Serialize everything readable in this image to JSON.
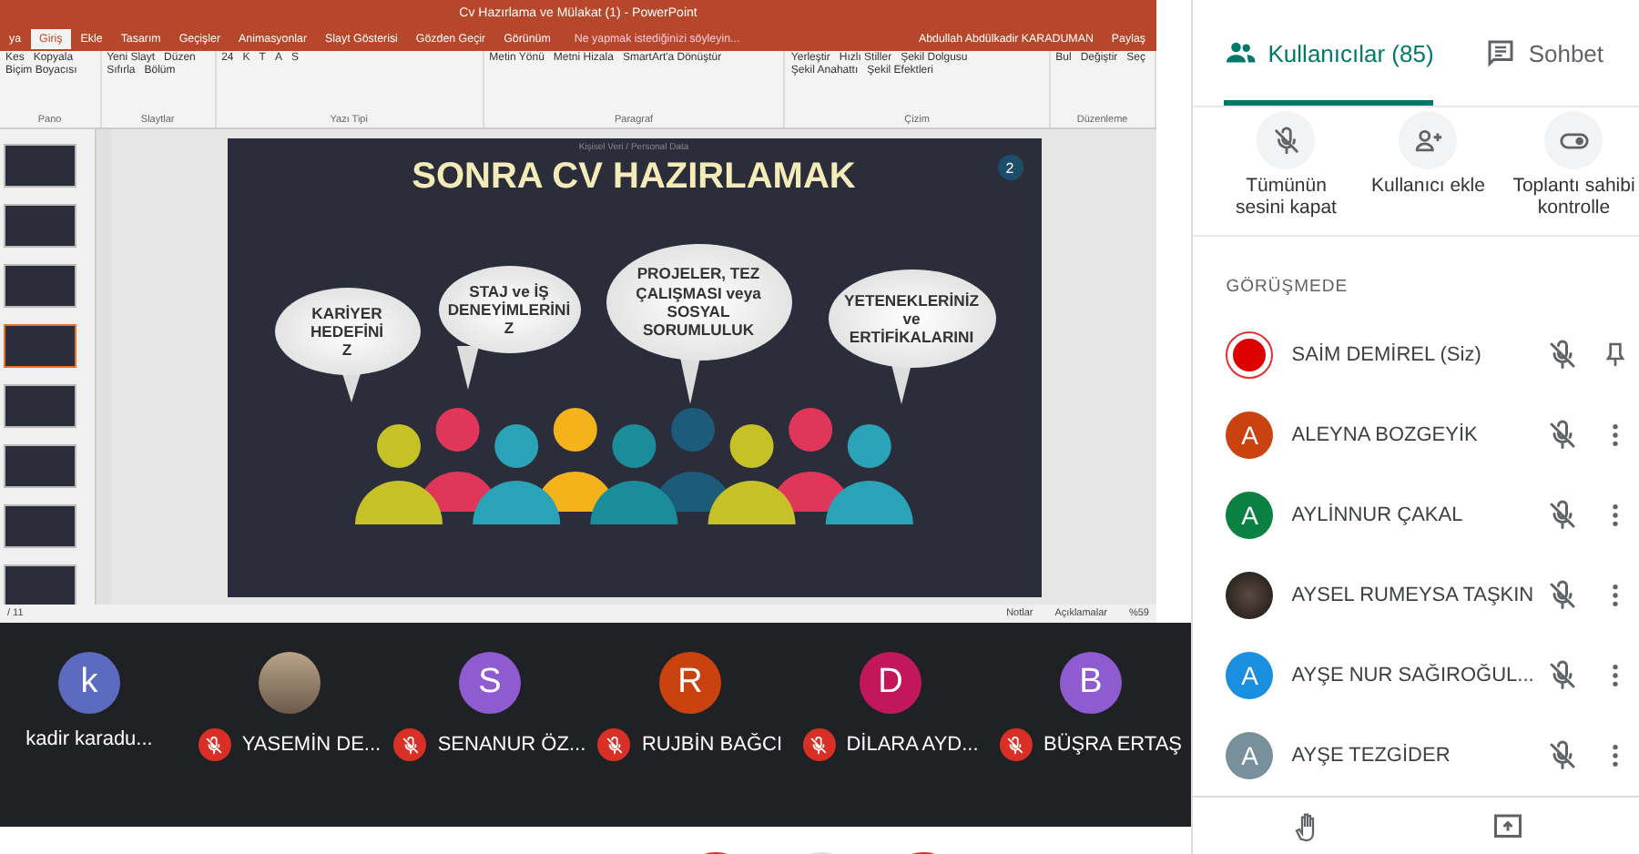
{
  "ppt": {
    "title": "Cv Hazırlama ve Mülakat (1) - PowerPoint",
    "tabs": [
      {
        "label": "ya",
        "selected": false
      },
      {
        "label": "Giriş",
        "selected": true
      },
      {
        "label": "Ekle",
        "selected": false
      },
      {
        "label": "Tasarım",
        "selected": false
      },
      {
        "label": "Geçişler",
        "selected": false
      },
      {
        "label": "Animasyonlar",
        "selected": false
      },
      {
        "label": "Slayt Gösterisi",
        "selected": false
      },
      {
        "label": "Gözden Geçir",
        "selected": false
      },
      {
        "label": "Görünüm",
        "selected": false
      }
    ],
    "tell_me": "Ne yapmak istediğinizi söyleyin...",
    "user": "Abdullah Abdülkadir KARADUMAN",
    "share": "Paylaş",
    "ribbon_groups": [
      {
        "label": "Pano",
        "items": [
          "Kes",
          "Kopyala",
          "Biçim Boyacısı"
        ]
      },
      {
        "label": "Slaytlar",
        "items": [
          "Yeni Slayt",
          "Düzen",
          "Sıfırla",
          "Bölüm"
        ]
      },
      {
        "label": "Yazı Tipi",
        "items": [
          "24",
          "K",
          "T",
          "A",
          "S"
        ]
      },
      {
        "label": "Paragraf",
        "items": [
          "Metin Yönü",
          "Metni Hizala",
          "SmartArt'a Dönüştür"
        ]
      },
      {
        "label": "Çizim",
        "items": [
          "Yerleştir",
          "Hızlı Stiller",
          "Şekil Dolgusu",
          "Şekil Anahattı",
          "Şekil Efektleri"
        ]
      },
      {
        "label": "Düzenleme",
        "items": [
          "Bul",
          "Değiştir",
          "Seç"
        ]
      }
    ],
    "thumbnails": [
      {
        "selected": false
      },
      {
        "selected": false
      },
      {
        "selected": false
      },
      {
        "selected": true
      },
      {
        "selected": false
      },
      {
        "selected": false
      },
      {
        "selected": false
      },
      {
        "selected": false
      }
    ],
    "slide": {
      "caption": "Kişisel Veri / Personal Data",
      "title": "SONRA CV HAZIRLAMAK",
      "number": "2",
      "bubbles": [
        {
          "lines": [
            "KARİYER",
            "HEDEFİNİ",
            "Z"
          ]
        },
        {
          "lines": [
            "STAJ ve İŞ",
            "DENEYİMLERİNİ",
            "Z"
          ]
        },
        {
          "lines": [
            "PROJELER, TEZ",
            "ÇALIŞMASI veya",
            "SOSYAL",
            "SORUMLULUK"
          ]
        },
        {
          "lines": [
            "YETENEKLERİNİZ",
            "ve",
            "ERTİFİKALARINI"
          ]
        }
      ]
    },
    "status": {
      "slide_count": "/ 11",
      "notes": "Notlar",
      "comments": "Açıklamalar",
      "zoom": "%59"
    }
  },
  "strip": [
    {
      "name": "kadir karadu...",
      "kind": "initial",
      "initial": "k",
      "color": "#5c6bc0",
      "muted": false
    },
    {
      "name": "YASEMİN DE...",
      "kind": "photo",
      "muted": true
    },
    {
      "name": "SENANUR ÖZ...",
      "kind": "initial",
      "initial": "S",
      "color": "#8e5bd0",
      "muted": true
    },
    {
      "name": "RUJBİN BAĞCI",
      "kind": "initial",
      "initial": "R",
      "color": "#c9420f",
      "muted": true
    },
    {
      "name": "DİLARA AYD...",
      "kind": "initial",
      "initial": "D",
      "color": "#c2185b",
      "muted": true
    },
    {
      "name": "BÜŞRA ERTAŞ",
      "kind": "initial",
      "initial": "B",
      "color": "#8e5bd0",
      "muted": true
    }
  ],
  "panel": {
    "tabs": [
      {
        "label": "Kullanıcılar (85)",
        "kind": "people",
        "selected": true
      },
      {
        "label": "Sohbet",
        "kind": "chat",
        "selected": false
      }
    ],
    "actions": [
      {
        "label": "Tümünün sesini kapat",
        "kind": "mute"
      },
      {
        "label": "Kullanıcı ekle",
        "kind": "add"
      },
      {
        "label": "Toplantı sahibi kontrolle",
        "kind": "toggle"
      }
    ],
    "section": "GÖRÜŞMEDE",
    "people": [
      {
        "name": "SAİM DEMİREL (Siz)",
        "kind": "logo",
        "self": true
      },
      {
        "name": "ALEYNA BOZGEYİK",
        "kind": "initial",
        "initial": "A",
        "color": "#c9420f",
        "self": false
      },
      {
        "name": "AYLİNNUR ÇAKAL",
        "kind": "initial",
        "initial": "A",
        "color": "#0b8043",
        "self": false
      },
      {
        "name": "AYSEL RUMEYSA TAŞKIN",
        "kind": "photo",
        "self": false
      },
      {
        "name": "AYŞE NUR SAĞIROĞUL...",
        "kind": "initial",
        "initial": "A",
        "color": "#1a8fe0",
        "self": false
      },
      {
        "name": "AYŞE TEZGİDER",
        "kind": "initial",
        "initial": "A",
        "color": "#78909c",
        "self": false
      }
    ]
  }
}
